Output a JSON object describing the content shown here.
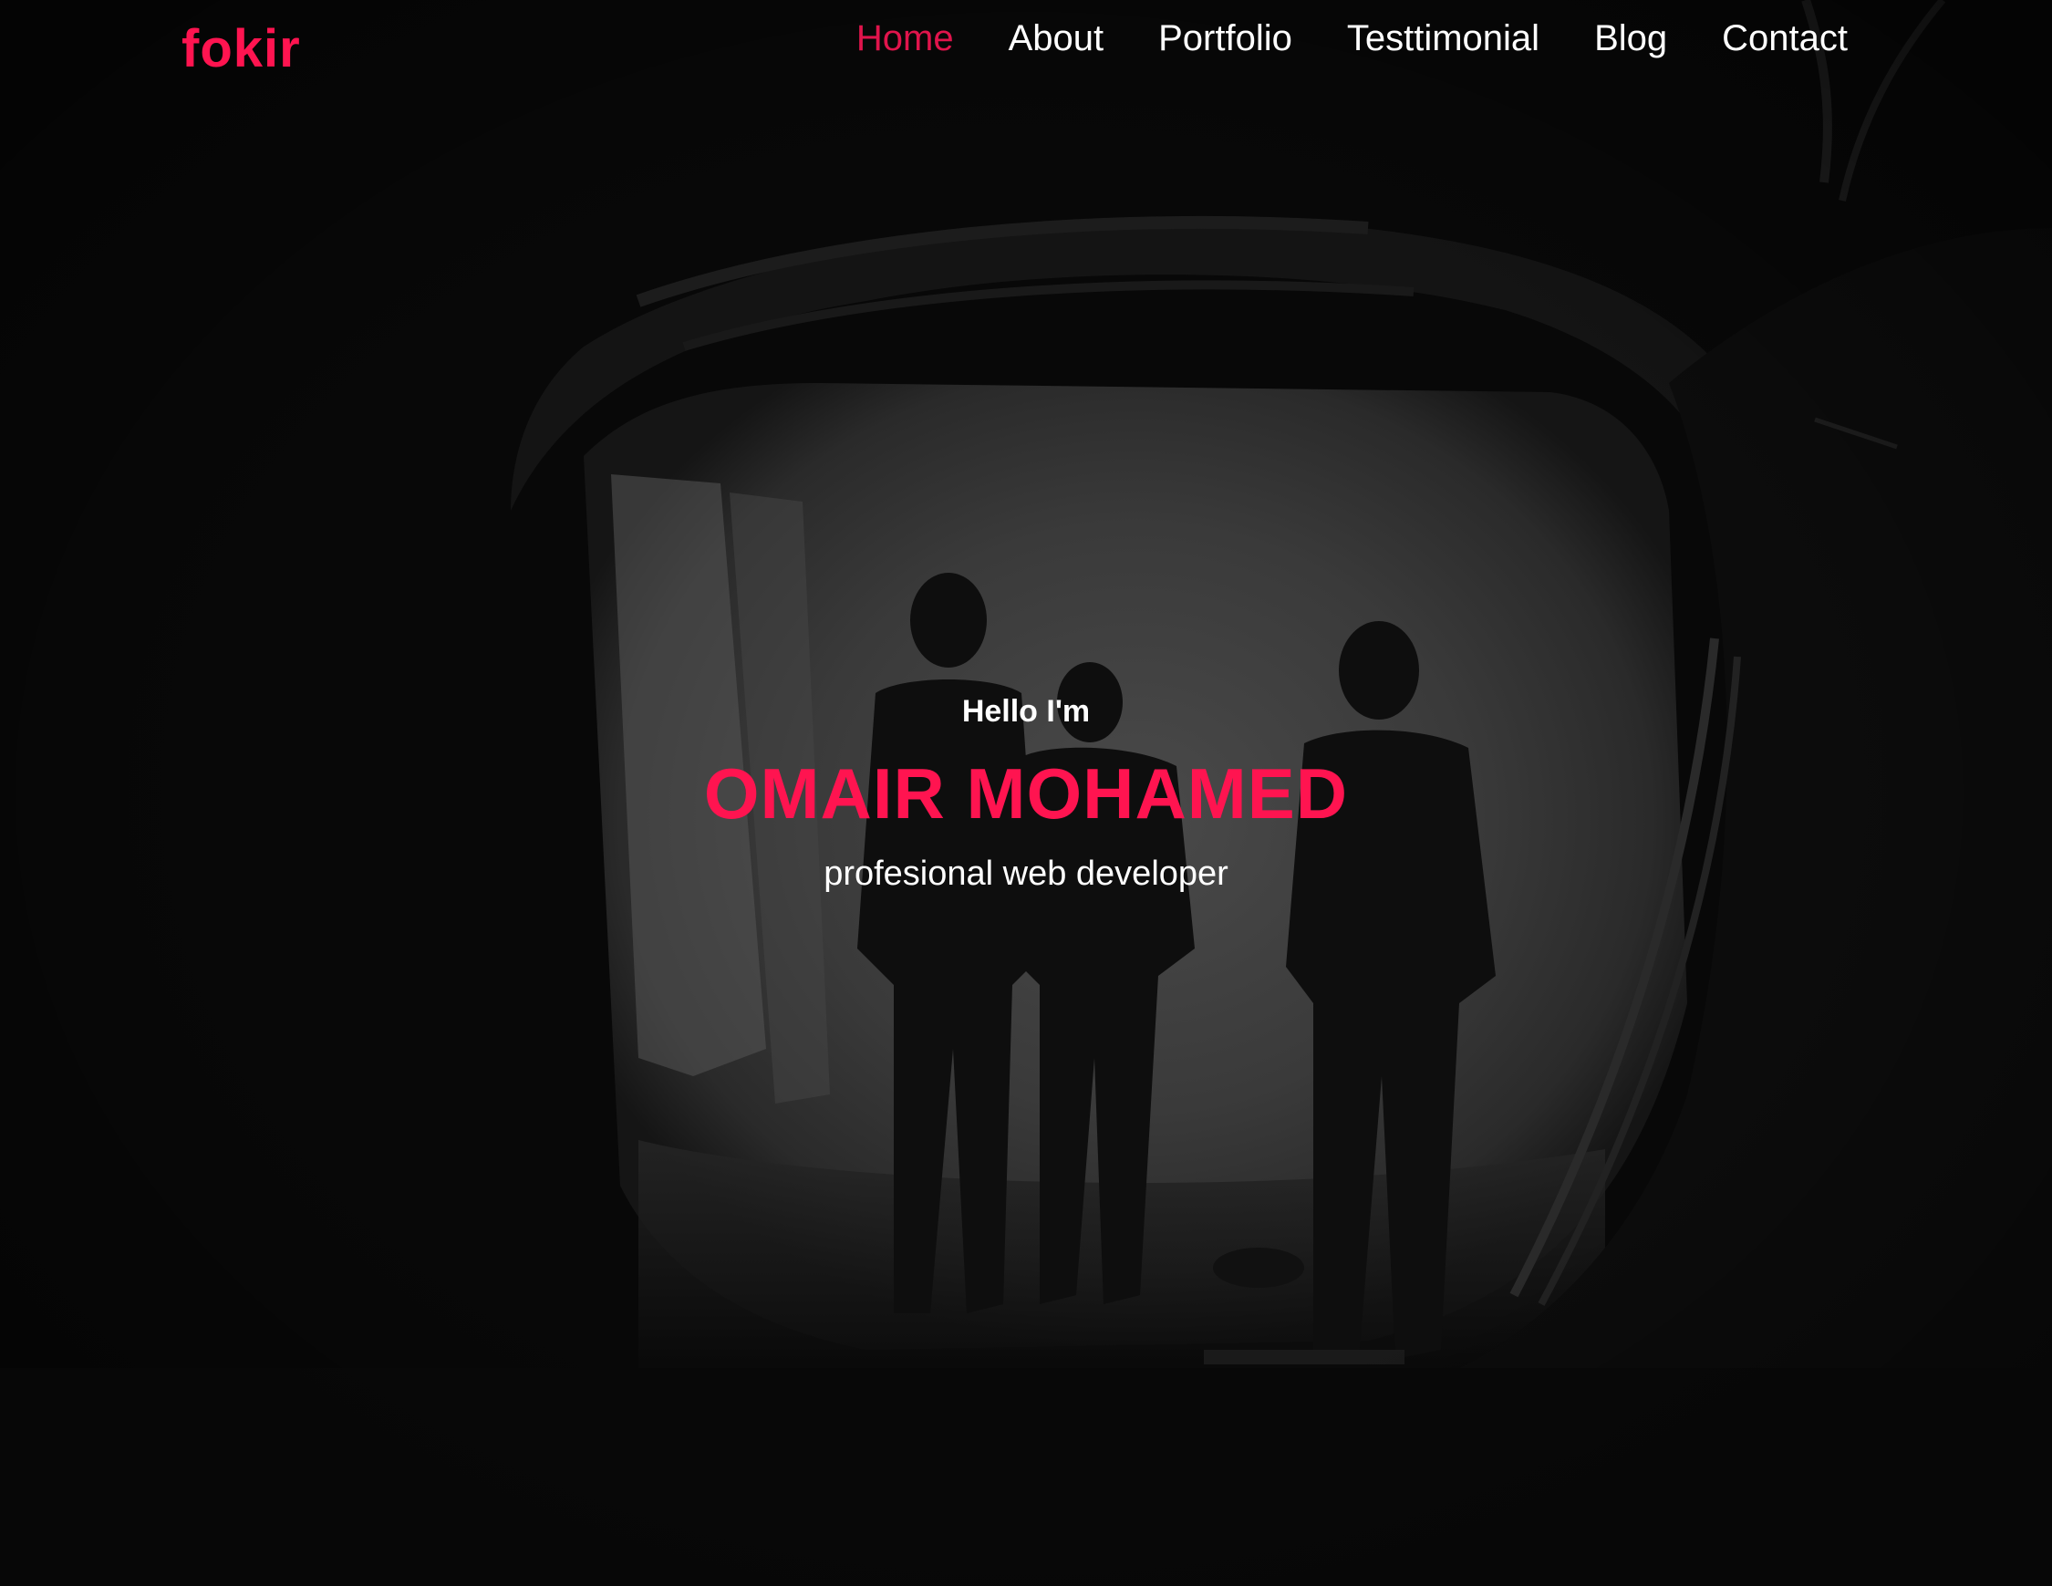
{
  "brand": {
    "logo_text": "fokir",
    "accent_color": "#ff1450"
  },
  "nav": {
    "items": [
      {
        "label": "Home",
        "active": true
      },
      {
        "label": "About",
        "active": false
      },
      {
        "label": "Portfolio",
        "active": false
      },
      {
        "label": "Testtimonial",
        "active": false
      },
      {
        "label": "Blog",
        "active": false
      },
      {
        "label": "Contact",
        "active": false
      }
    ]
  },
  "hero": {
    "greeting": "Hello I'm",
    "name": "OMAIR MOHAMED",
    "role": "profesional web developer",
    "background_image": "dark monochrome photo of three silhouetted people walking out of a cave tunnel"
  }
}
